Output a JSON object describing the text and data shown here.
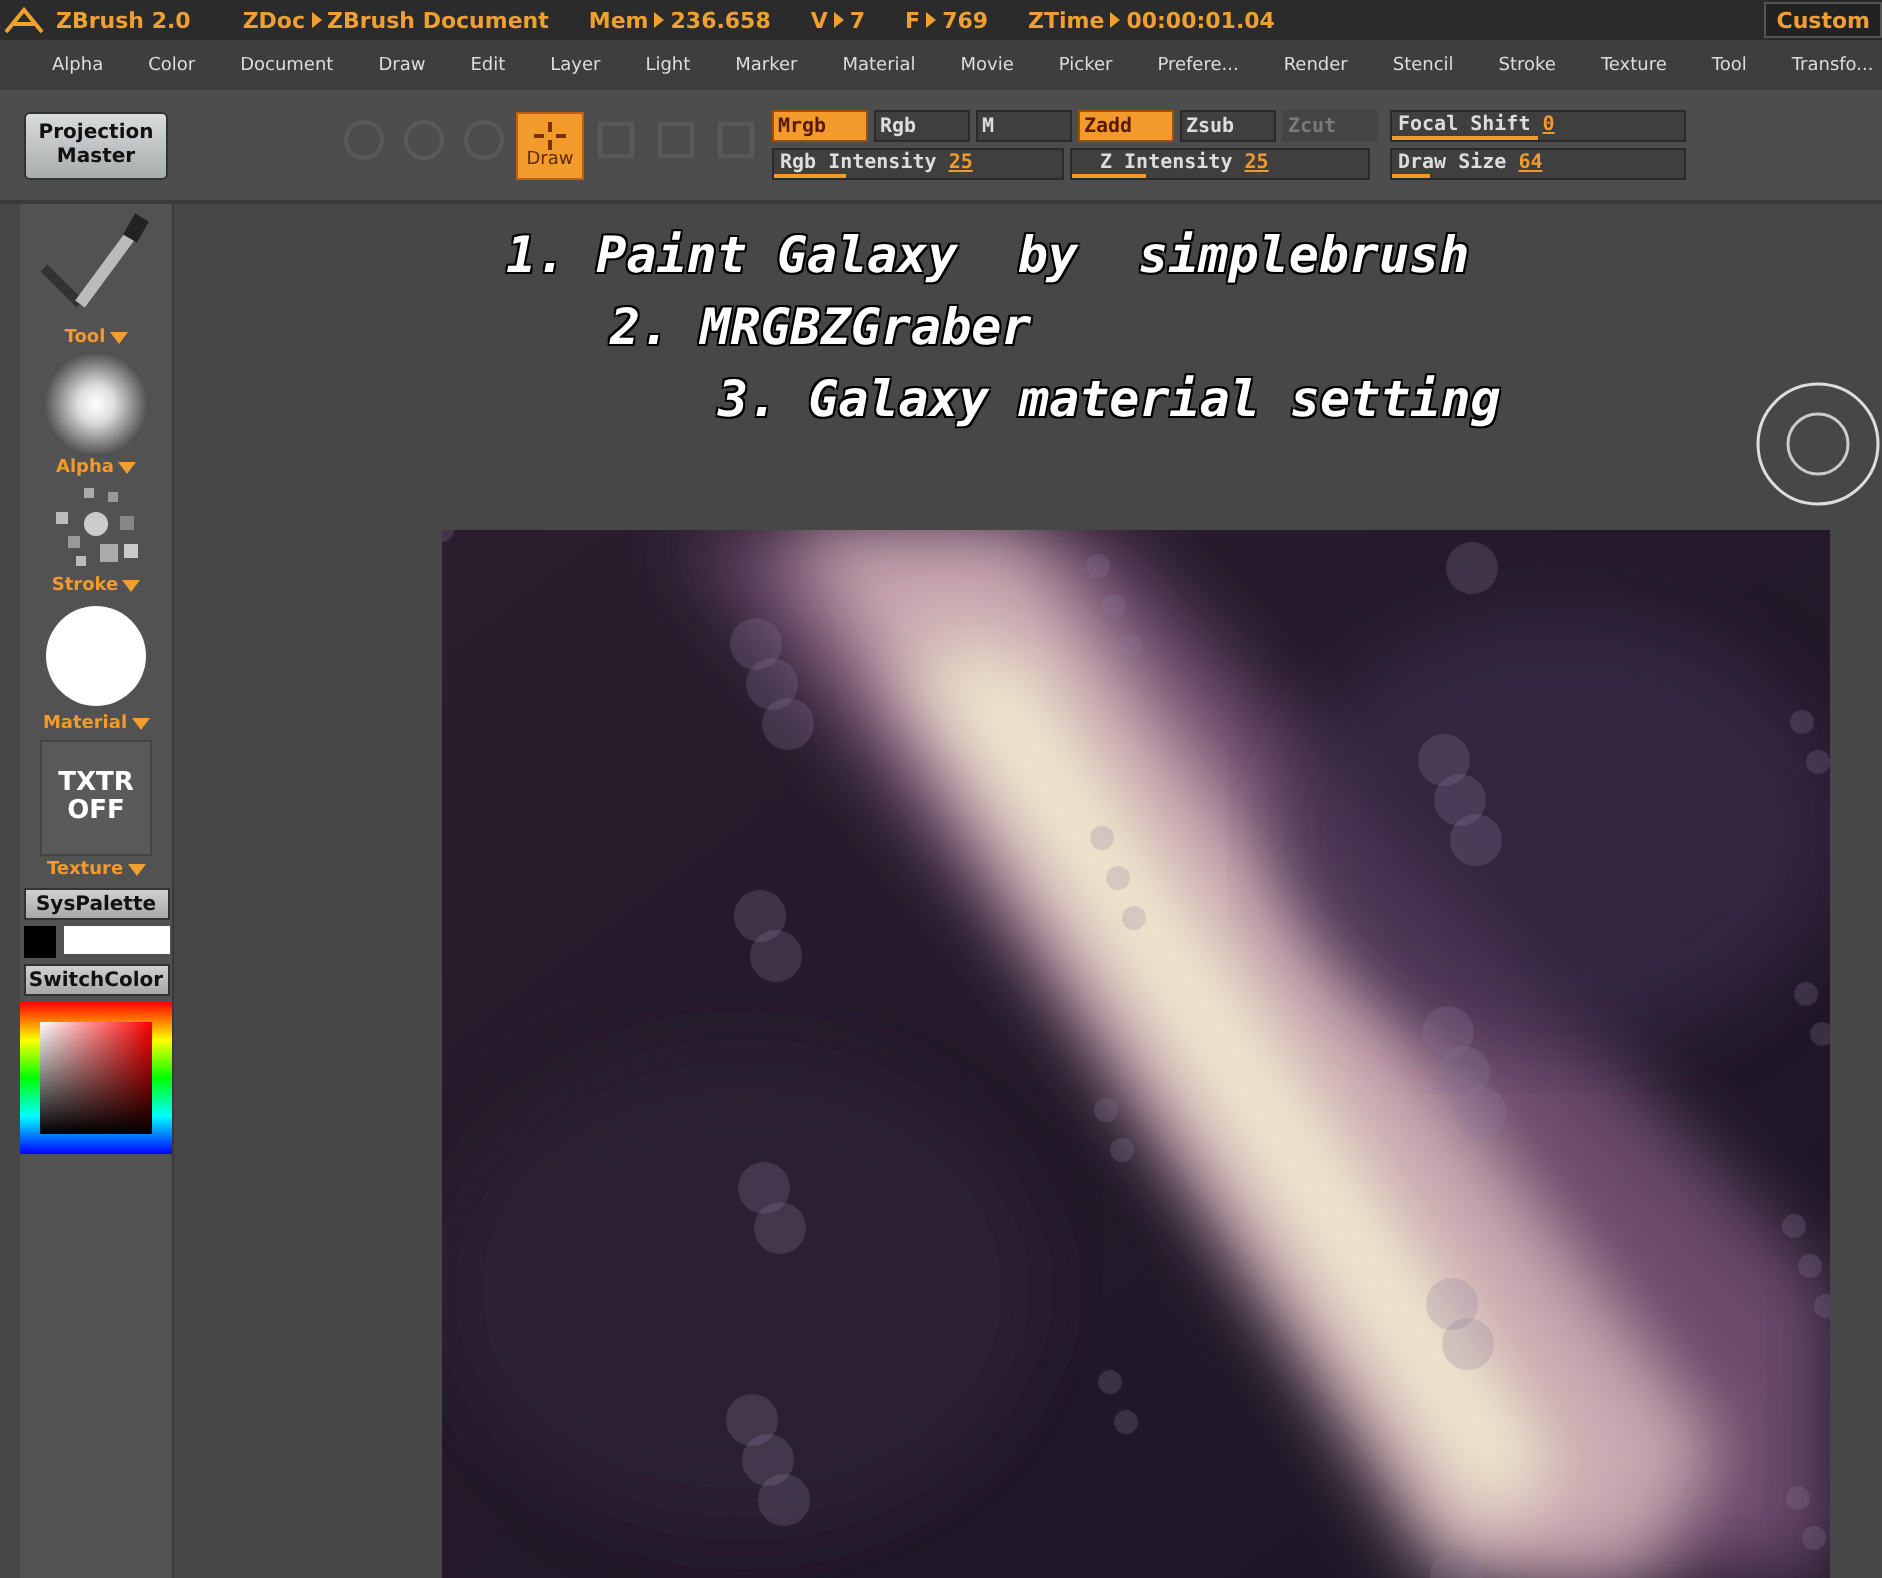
{
  "title_bar": {
    "app": "ZBrush 2.0",
    "stats": [
      {
        "label": "ZDoc",
        "value": "ZBrush Document"
      },
      {
        "label": "Mem",
        "value": "236.658"
      },
      {
        "label": "V",
        "value": "7"
      },
      {
        "label": "F",
        "value": "769"
      },
      {
        "label": "ZTime",
        "value": "00:00:01.04"
      }
    ],
    "custom_button": "Custom"
  },
  "menu": [
    "Alpha",
    "Color",
    "Document",
    "Draw",
    "Edit",
    "Layer",
    "Light",
    "Marker",
    "Material",
    "Movie",
    "Picker",
    "Prefere...",
    "Render",
    "Stencil",
    "Stroke",
    "Texture",
    "Tool",
    "Transfo..."
  ],
  "toolbar": {
    "projection_master": "Projection Master",
    "draw_button": {
      "label": "Draw",
      "selected": true
    },
    "channels": [
      {
        "label": "Mrgb",
        "selected": true,
        "disabled": false
      },
      {
        "label": "Rgb",
        "selected": false,
        "disabled": false
      },
      {
        "label": "M",
        "selected": false,
        "disabled": false
      },
      {
        "label": "Zadd",
        "selected": true,
        "disabled": false
      },
      {
        "label": "Zsub",
        "selected": false,
        "disabled": false
      },
      {
        "label": "Zcut",
        "selected": false,
        "disabled": true
      }
    ],
    "sliders": [
      {
        "label": "Rgb Intensity",
        "value": "25",
        "level": 0.25
      },
      {
        "label": "Z Intensity",
        "value": "25",
        "level": 0.25
      }
    ],
    "right_sliders": [
      {
        "label": "Focal Shift",
        "value": "0",
        "level": 0.5
      },
      {
        "label": "Draw Size",
        "value": "64",
        "level": 0.13
      }
    ]
  },
  "sidebar": {
    "items": [
      {
        "kind": "tool",
        "label": "Tool"
      },
      {
        "kind": "alpha",
        "label": "Alpha"
      },
      {
        "kind": "stroke",
        "label": "Stroke"
      },
      {
        "kind": "material",
        "label": "Material"
      },
      {
        "kind": "texture",
        "label": "Texture",
        "thumb": "TXTR OFF"
      }
    ],
    "sys_palette": "SysPalette",
    "switch_color": "SwitchColor"
  },
  "canvas": {
    "notes": [
      "1. Paint Galaxy  by  simplebrush",
      "2. MRGBZGraber",
      "3. Galaxy material setting"
    ]
  }
}
